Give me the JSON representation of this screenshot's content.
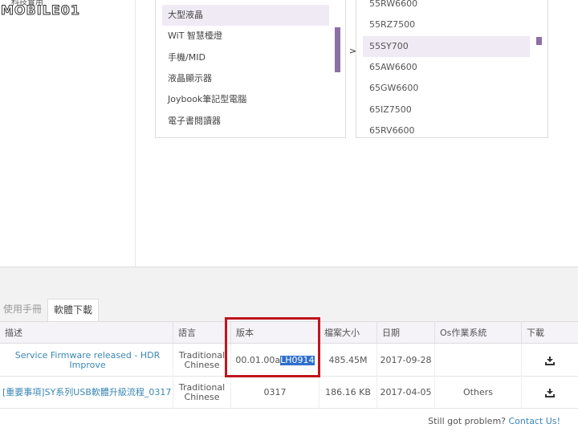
{
  "logo": {
    "small_text": "科技實用",
    "brand_text": "MOBILE01"
  },
  "categories": {
    "items": [
      {
        "label": "大型液晶",
        "active": true
      },
      {
        "label": "WiT 智慧檯燈",
        "active": false
      },
      {
        "label": "手機/MID",
        "active": false
      },
      {
        "label": "液晶顯示器",
        "active": false
      },
      {
        "label": "Joybook筆記型電腦",
        "active": false
      },
      {
        "label": "電子書閱讀器",
        "active": false
      }
    ]
  },
  "arrow": ">",
  "models": {
    "items": [
      {
        "label": "55RW6600",
        "active": false
      },
      {
        "label": "55RZ7500",
        "active": false
      },
      {
        "label": "55SY700",
        "active": true
      },
      {
        "label": "65AW6600",
        "active": false
      },
      {
        "label": "65GW6600",
        "active": false
      },
      {
        "label": "65IZ7500",
        "active": false
      },
      {
        "label": "65RV6600",
        "active": false
      }
    ]
  },
  "tabs": {
    "manual": "使用手冊",
    "software": "軟體下載"
  },
  "table": {
    "headers": {
      "desc": "描述",
      "lang": "語言",
      "version": "版本",
      "size": "檔案大小",
      "date": "日期",
      "os": "Os作業系統",
      "download": "下載"
    },
    "rows": [
      {
        "desc": "Service Firmware released - HDR Improve",
        "lang_1": "Traditional",
        "lang_2": "Chinese",
        "version_prefix": "00.01.00a",
        "version_selected": "LH0914",
        "size": "485.45M",
        "date": "2017-09-28",
        "os": ""
      },
      {
        "desc": "[重要事項]SY系列USB軟體升級流程_0317",
        "lang_1": "Traditional",
        "lang_2": "Chinese",
        "version": "0317",
        "size": "186.16 KB",
        "date": "2017-04-05",
        "os": "Others"
      }
    ]
  },
  "footer": {
    "question": "Still got problem?",
    "link": "Contact Us!"
  },
  "colors": {
    "accent": "#8b6fa6",
    "link": "#3a86b4",
    "highlight": "#c0161e",
    "selection": "#2f6fcc"
  }
}
